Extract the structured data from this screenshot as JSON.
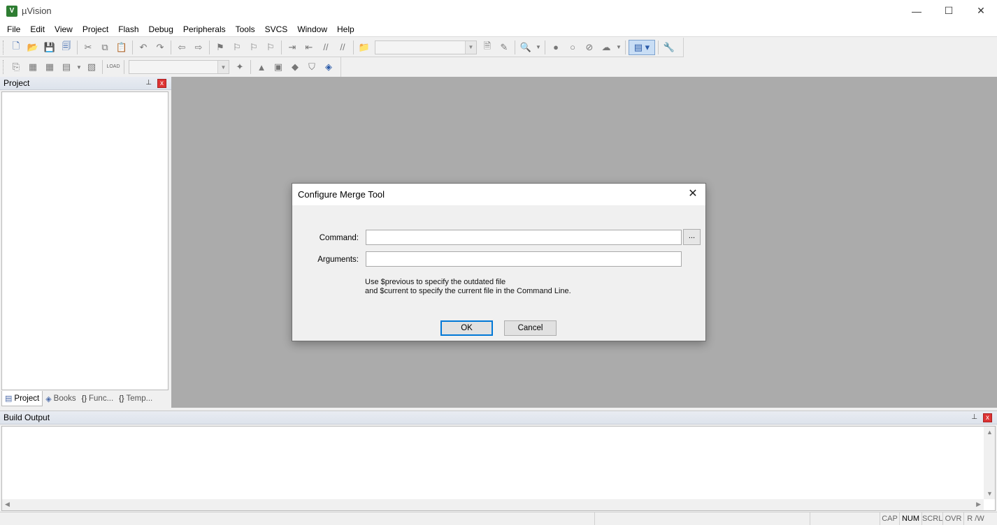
{
  "window": {
    "title": "µVision",
    "app_icon": "V",
    "minimize_glyph": "—",
    "maximize_glyph": "☐",
    "close_glyph": "✕"
  },
  "menu": [
    "File",
    "Edit",
    "View",
    "Project",
    "Flash",
    "Debug",
    "Peripherals",
    "Tools",
    "SVCS",
    "Window",
    "Help"
  ],
  "toolbar": {
    "load_label": "LOAD"
  },
  "project_pane": {
    "title": "Project",
    "pin_glyph": "📌",
    "close_glyph": "x",
    "tabs": [
      {
        "label": "Project",
        "icon": "project-icon",
        "glyph": "▤"
      },
      {
        "label": "Books",
        "icon": "books-icon",
        "glyph": "◈"
      },
      {
        "label": "Func...",
        "icon": "functions-icon",
        "glyph": "{}"
      },
      {
        "label": "Temp...",
        "icon": "templates-icon",
        "glyph": "{}"
      }
    ]
  },
  "output_pane": {
    "title": "Build Output"
  },
  "statusbar": {
    "cells": [
      {
        "label": "CAP",
        "active": false
      },
      {
        "label": "NUM",
        "active": true
      },
      {
        "label": "SCRL",
        "active": false
      },
      {
        "label": "OVR",
        "active": false
      },
      {
        "label": "R /W",
        "active": false
      }
    ]
  },
  "dialog": {
    "title": "Configure Merge Tool",
    "close_glyph": "✕",
    "command_label": "Command:",
    "command_value": "",
    "browse_label": "...",
    "arguments_label": "Arguments:",
    "arguments_value": "",
    "help_line1": "Use $previous to specify the outdated file",
    "help_line2": "and $current to specify the current file in the Command Line.",
    "ok_label": "OK",
    "cancel_label": "Cancel"
  },
  "colors": {
    "workspace": "#ababab",
    "accent": "#0078d7",
    "close_red": "#dd3333"
  }
}
